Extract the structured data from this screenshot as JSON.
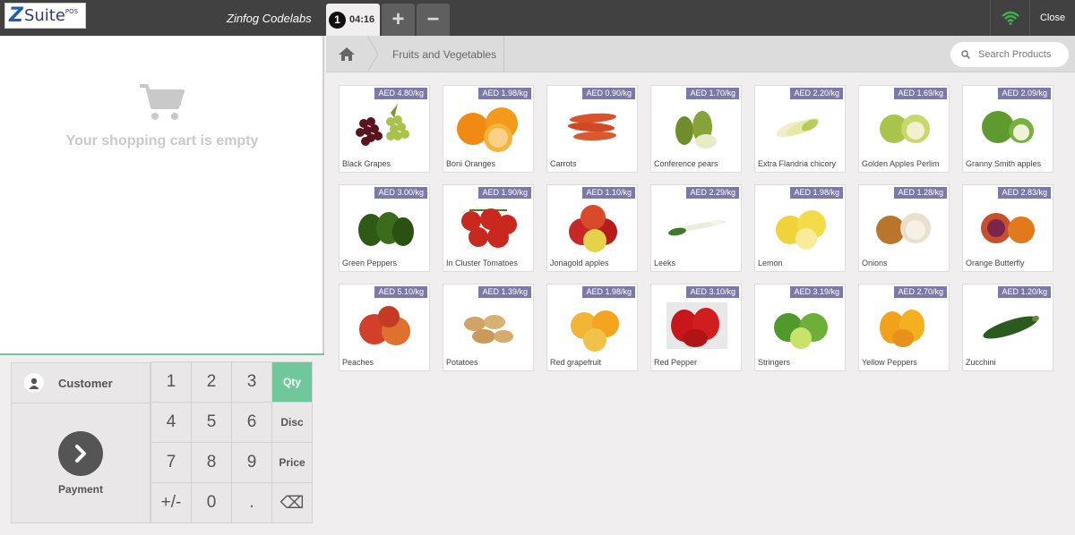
{
  "header": {
    "logo": {
      "z": "Z",
      "suite": "Suite",
      "pos": "POS"
    },
    "company": "Zinfog Codelabs",
    "order": {
      "number": "1",
      "time": "04:16"
    },
    "add_order": "+",
    "remove_order": "−",
    "close": "Close"
  },
  "cart": {
    "empty_text": "Your shopping cart is empty"
  },
  "pad": {
    "customer": "Customer",
    "payment": "Payment",
    "keys": [
      "1",
      "2",
      "3",
      "Qty",
      "4",
      "5",
      "6",
      "Disc",
      "7",
      "8",
      "9",
      "Price",
      "+/-",
      "0",
      ".",
      "⌫"
    ],
    "active_mode": "Qty"
  },
  "breadcrumb": {
    "category": "Fruits and Vegetables"
  },
  "search": {
    "placeholder": "Search Products"
  },
  "products": [
    {
      "name": "Black Grapes",
      "price": "AED 4.80/kg",
      "icon": "grapes"
    },
    {
      "name": "Boni Oranges",
      "price": "AED 1.98/kg",
      "icon": "oranges"
    },
    {
      "name": "Carrots",
      "price": "AED 0.90/kg",
      "icon": "carrots"
    },
    {
      "name": "Conference pears",
      "price": "AED 1.70/kg",
      "icon": "pears"
    },
    {
      "name": "Extra Flandria chicory",
      "price": "AED 2.20/kg",
      "icon": "chicory"
    },
    {
      "name": "Golden Apples Perlim",
      "price": "AED 1.69/kg",
      "icon": "golden-apples"
    },
    {
      "name": "Granny Smith apples",
      "price": "AED 2.09/kg",
      "icon": "green-apples"
    },
    {
      "name": "Green Peppers",
      "price": "AED 3.00/kg",
      "icon": "green-peppers"
    },
    {
      "name": "In Cluster Tomatoes",
      "price": "AED 1.90/kg",
      "icon": "tomatoes"
    },
    {
      "name": "Jonagold apples",
      "price": "AED 1.10/kg",
      "icon": "red-apples"
    },
    {
      "name": "Leeks",
      "price": "AED 2.29/kg",
      "icon": "leeks"
    },
    {
      "name": "Lemon",
      "price": "AED 1.98/kg",
      "icon": "lemons"
    },
    {
      "name": "Onions",
      "price": "AED 1.28/kg",
      "icon": "onions"
    },
    {
      "name": "Orange Butterfly",
      "price": "AED 2.83/kg",
      "icon": "orange-butterfly"
    },
    {
      "name": "Peaches",
      "price": "AED 5.10/kg",
      "icon": "peaches"
    },
    {
      "name": "Potatoes",
      "price": "AED 1.39/kg",
      "icon": "potatoes"
    },
    {
      "name": "Red grapefruit",
      "price": "AED 1.98/kg",
      "icon": "grapefruit"
    },
    {
      "name": "Red Pepper",
      "price": "AED 3.10/kg",
      "icon": "red-peppers"
    },
    {
      "name": "Stringers",
      "price": "AED 3.19/kg",
      "icon": "limes"
    },
    {
      "name": "Yellow Peppers",
      "price": "AED 2.70/kg",
      "icon": "yellow-peppers"
    },
    {
      "name": "Zucchini",
      "price": "AED 1.20/kg",
      "icon": "zucchini"
    }
  ],
  "colors": {
    "topbar": "#414141",
    "accent_green": "#6ec89b",
    "price_badge": "#7b79a8",
    "wifi": "#39b54a"
  }
}
